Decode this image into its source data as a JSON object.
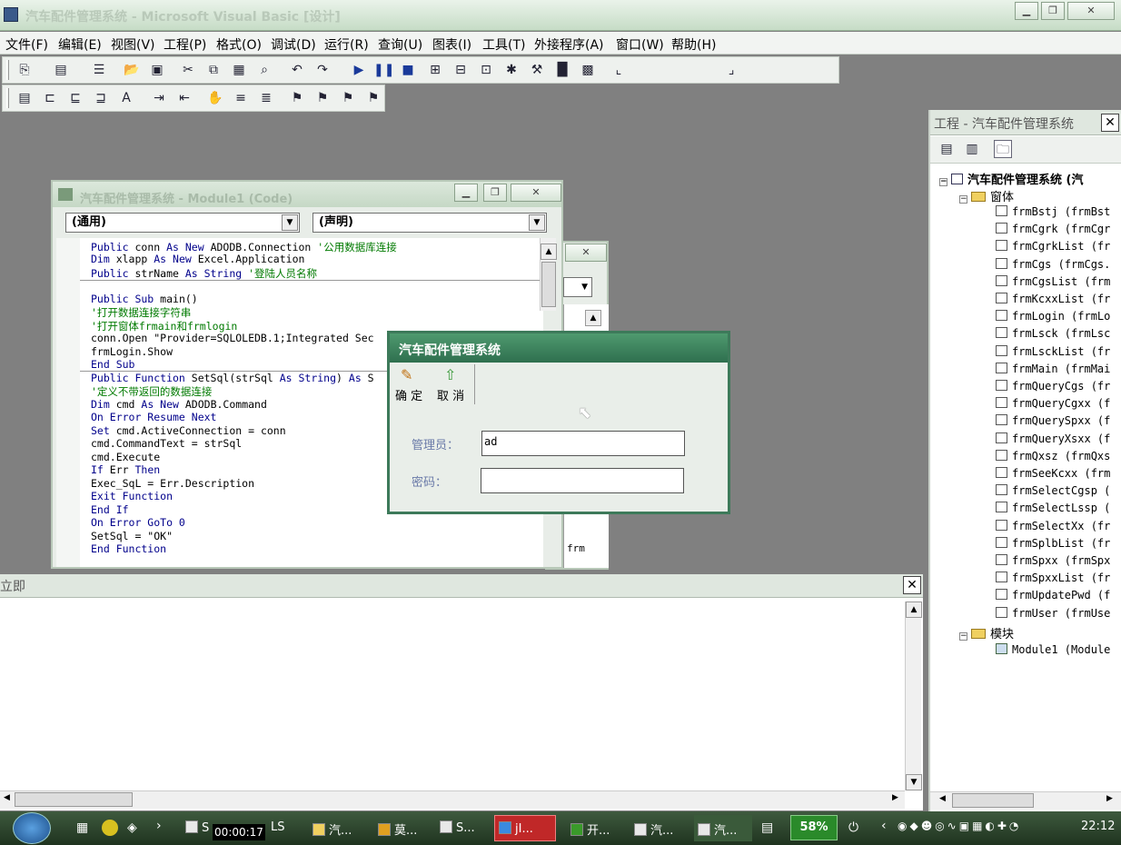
{
  "window": {
    "title": "汽车配件管理系统 - Microsoft Visual Basic [设计]"
  },
  "menu": [
    "文件(F)",
    "编辑(E)",
    "视图(V)",
    "工程(P)",
    "格式(O)",
    "调试(D)",
    "运行(R)",
    "查询(U)",
    "图表(I)",
    "工具(T)",
    "外接程序(A)",
    "窗口(W)",
    "帮助(H)"
  ],
  "code_window": {
    "title": "汽车配件管理系统 - Module1 (Code)",
    "object_combo": "(通用)",
    "proc_combo": "(声明)",
    "lines": [
      "Public conn As New ADODB.Connection '公用数据库连接",
      "Dim xlapp As New Excel.Application",
      "Public strName As String '登陆人员名称",
      "",
      "Public Sub main()",
      "'打开数据连接字符串",
      "'打开窗体frmain和frmlogin",
      "conn.Open \"Provider=SQLOLEDB.1;Integrated Sec",
      "frmLogin.Show",
      "End Sub",
      "Public Function SetSql(strSql As String) As S",
      "'定义不带返回的数据连接",
      "Dim cmd As New ADODB.Command",
      "On Error Resume Next",
      "Set cmd.ActiveConnection = conn",
      "    cmd.CommandText = strSql",
      "    cmd.Execute",
      "If Err Then",
      "   Exec_SqL = Err.Description",
      "   Exit Function",
      "End If",
      "On Error GoTo 0",
      "SetSql = \"OK\"",
      "End Function"
    ]
  },
  "back_window": {
    "text": "frm"
  },
  "login_dialog": {
    "title": "汽车配件管理系统",
    "ok_label": "确 定",
    "cancel_label": "取 消",
    "admin_label": "管理员：",
    "admin_value": "ad",
    "password_label": "密码：",
    "password_value": ""
  },
  "immediate": {
    "title": "立即"
  },
  "project": {
    "title": "工程 - 汽车配件管理系统",
    "root": "汽车配件管理系统 (汽",
    "forms_folder": "窗体",
    "forms": [
      "frmBstj (frmBst",
      "frmCgrk (frmCgr",
      "frmCgrkList (fr",
      "frmCgs (frmCgs.",
      "frmCgsList (frm",
      "frmKcxxList (fr",
      "frmLogin (frmLo",
      "frmLsck (frmLsc",
      "frmLsckList (fr",
      "frmMain (frmMai",
      "frmQueryCgs (fr",
      "frmQueryCgxx (f",
      "frmQuerySpxx (f",
      "frmQueryXsxx (f",
      "frmQxsz (frmQxs",
      "frmSeeKcxx (frm",
      "frmSelectCgsp (",
      "frmSelectLssp (",
      "frmSelectXx (fr",
      "frmSplbList (fr",
      "frmSpxx (frmSpx",
      "frmSpxxList (fr",
      "frmUpdatePwd (f",
      "frmUser (frmUse"
    ],
    "modules_folder": "模块",
    "modules": [
      "Module1 (Module"
    ]
  },
  "taskbar": {
    "timer": "00:00:17",
    "items": [
      "S",
      "LS",
      "汽...",
      "莫...",
      "S...",
      "jI...",
      "开...",
      "汽...",
      "汽..."
    ],
    "battery": "58%",
    "clock": "22:12"
  }
}
